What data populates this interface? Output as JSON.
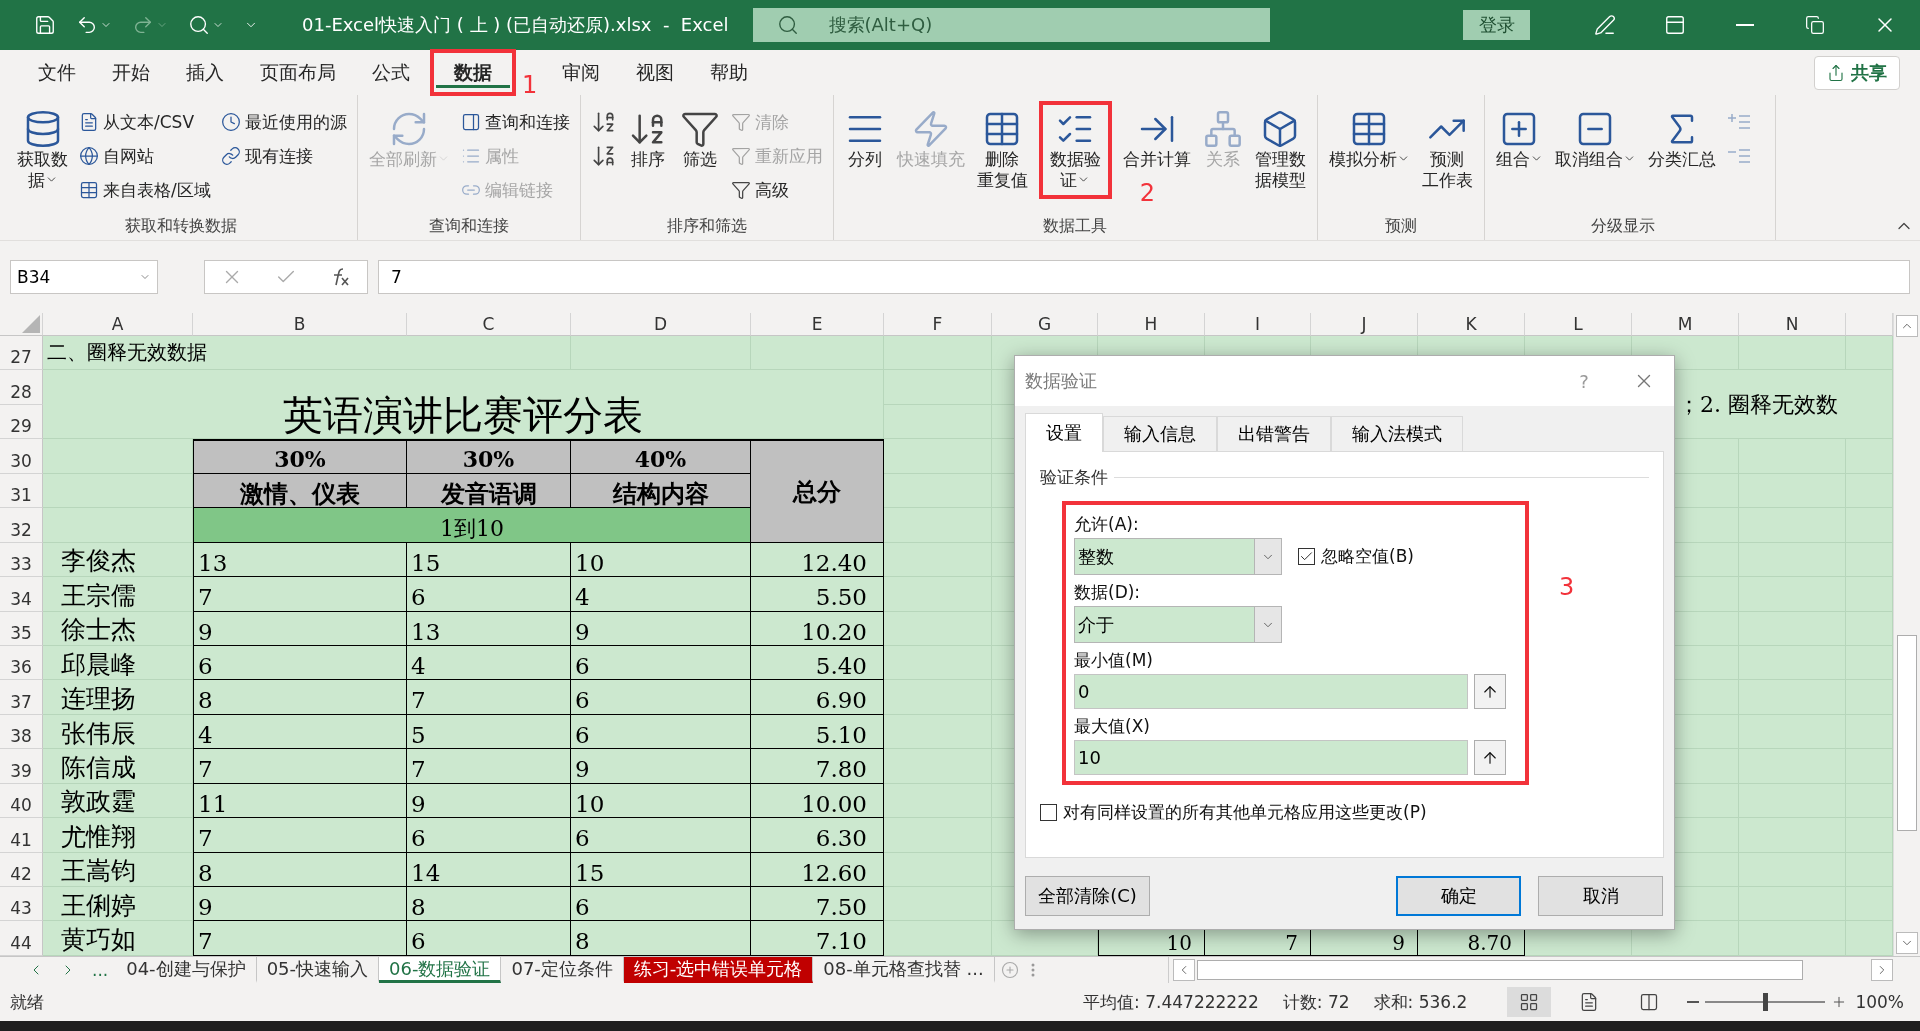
{
  "window": {
    "title": "01-Excel快速入门 ( 上 ) (已自动还原).xlsx  -  Excel",
    "search_placeholder": "搜索(Alt+Q)",
    "login": "登录"
  },
  "menu_tabs": [
    {
      "label": "文件",
      "selected": false
    },
    {
      "label": "开始",
      "selected": false
    },
    {
      "label": "插入",
      "selected": false
    },
    {
      "label": "页面布局",
      "selected": false
    },
    {
      "label": "公式",
      "selected": false
    },
    {
      "label": "数据",
      "selected": true
    },
    {
      "label": "审阅",
      "selected": false
    },
    {
      "label": "视图",
      "selected": false
    },
    {
      "label": "帮助",
      "selected": false
    }
  ],
  "share": "共享",
  "ribbon_groups": [
    {
      "label": "获取和转换数据",
      "items": [
        {
          "kind": "large",
          "lines": [
            "获取数",
            "据"
          ],
          "menu": true,
          "disabled": false
        },
        {
          "kind": "stack",
          "items": [
            {
              "label": "从文本/CSV",
              "disabled": false
            },
            {
              "label": "自网站",
              "disabled": false
            },
            {
              "label": "来自表格/区域",
              "disabled": false
            }
          ]
        },
        {
          "kind": "stack",
          "items": [
            {
              "label": "最近使用的源",
              "disabled": false
            },
            {
              "label": "现有连接",
              "disabled": false
            }
          ]
        }
      ]
    },
    {
      "label": "查询和连接",
      "items": [
        {
          "kind": "large",
          "lines": [
            "全部刷新"
          ],
          "menu": true,
          "disabled": true
        },
        {
          "kind": "stack",
          "items": [
            {
              "label": "查询和连接",
              "disabled": false
            },
            {
              "label": "属性",
              "disabled": true
            },
            {
              "label": "编辑链接",
              "disabled": true
            }
          ]
        }
      ]
    },
    {
      "label": "排序和筛选",
      "items": [
        {
          "kind": "icons",
          "items": [
            {
              "disabled": false
            },
            {
              "disabled": false
            }
          ]
        },
        {
          "kind": "large",
          "lines": [
            "排序"
          ],
          "menu": false,
          "disabled": false
        },
        {
          "kind": "large",
          "lines": [
            "筛选"
          ],
          "menu": false,
          "disabled": false
        },
        {
          "kind": "stack",
          "items": [
            {
              "label": "清除",
              "disabled": true
            },
            {
              "label": "重新应用",
              "disabled": true
            },
            {
              "label": "高级",
              "disabled": false
            }
          ]
        }
      ]
    },
    {
      "label": "数据工具",
      "items": [
        {
          "kind": "large",
          "lines": [
            "分列"
          ],
          "menu": false,
          "disabled": false
        },
        {
          "kind": "large",
          "lines": [
            "快速填充"
          ],
          "menu": false,
          "disabled": true
        },
        {
          "kind": "large",
          "lines": [
            "删除",
            "重复值"
          ],
          "menu": false,
          "disabled": false
        },
        {
          "kind": "large",
          "lines": [
            "数据验",
            "证"
          ],
          "menu": true,
          "disabled": false
        },
        {
          "kind": "large",
          "lines": [
            "合并计算"
          ],
          "menu": false,
          "disabled": false
        },
        {
          "kind": "large",
          "lines": [
            "关系"
          ],
          "menu": false,
          "disabled": true
        },
        {
          "kind": "large",
          "lines": [
            "管理数",
            "据模型"
          ],
          "menu": false,
          "disabled": false
        }
      ]
    },
    {
      "label": "预测",
      "items": [
        {
          "kind": "large",
          "lines": [
            "模拟分析"
          ],
          "menu": true,
          "disabled": false
        },
        {
          "kind": "large",
          "lines": [
            "预测",
            "工作表"
          ],
          "menu": false,
          "disabled": false
        }
      ]
    },
    {
      "label": "分级显示",
      "items": [
        {
          "kind": "large",
          "lines": [
            "组合"
          ],
          "menu": true,
          "disabled": false
        },
        {
          "kind": "large",
          "lines": [
            "取消组合"
          ],
          "menu": true,
          "disabled": false
        },
        {
          "kind": "large",
          "lines": [
            "分类汇总"
          ],
          "menu": false,
          "disabled": false
        },
        {
          "kind": "icons",
          "items": [
            {
              "disabled": true
            },
            {
              "disabled": true
            }
          ]
        }
      ]
    }
  ],
  "annotations": [
    {
      "number": "1"
    },
    {
      "number": "2"
    },
    {
      "number": "3"
    }
  ],
  "formula_bar": {
    "name_box": "B34",
    "formula": "7"
  },
  "sheet": {
    "columns": [
      "A",
      "B",
      "C",
      "D",
      "E",
      "F",
      "G",
      "H",
      "I",
      "J",
      "K",
      "L",
      "M",
      "N"
    ],
    "row_numbers": [
      "27",
      "28",
      "29",
      "30",
      "31",
      "32",
      "33",
      "34",
      "35",
      "36",
      "37",
      "38",
      "39",
      "40",
      "41",
      "42",
      "43",
      "44"
    ],
    "section_title": "二、圈释无效数据",
    "table_title": "英语演讲比赛评分表",
    "weights": [
      "30%",
      "30%",
      "40%"
    ],
    "criteria": [
      "激情、仪表",
      "发音语调",
      "结构内容"
    ],
    "total_header": "总分",
    "range_note": "1到10",
    "records": [
      {
        "name": "李俊杰",
        "scores": [
          "13",
          "15",
          "10"
        ],
        "total": "12.40"
      },
      {
        "name": "王宗儒",
        "scores": [
          "7",
          "6",
          "4"
        ],
        "total": "5.50"
      },
      {
        "name": "徐士杰",
        "scores": [
          "9",
          "13",
          "9"
        ],
        "total": "10.20"
      },
      {
        "name": "邱晨峰",
        "scores": [
          "6",
          "4",
          "6"
        ],
        "total": "5.40"
      },
      {
        "name": "连理扬",
        "scores": [
          "8",
          "7",
          "6"
        ],
        "total": "6.90"
      },
      {
        "name": "张伟辰",
        "scores": [
          "4",
          "5",
          "6"
        ],
        "total": "5.10"
      },
      {
        "name": "陈信成",
        "scores": [
          "7",
          "7",
          "9"
        ],
        "total": "7.80"
      },
      {
        "name": "敦政霆",
        "scores": [
          "11",
          "9",
          "10"
        ],
        "total": "10.00"
      },
      {
        "name": "尤惟翔",
        "scores": [
          "7",
          "6",
          "6"
        ],
        "total": "6.30"
      },
      {
        "name": "王嵩钧",
        "scores": [
          "8",
          "14",
          "15"
        ],
        "total": "12.60"
      },
      {
        "name": "王俐婷",
        "scores": [
          "9",
          "8",
          "6"
        ],
        "total": "7.50"
      },
      {
        "name": "黄巧如",
        "scores": [
          "7",
          "6",
          "8"
        ],
        "total": "7.10"
      }
    ],
    "side_note": "；2. 圈释无效数",
    "background_row": [
      "10",
      "7",
      "9",
      "8.70"
    ]
  },
  "dialog": {
    "title": "数据验证",
    "help": "?",
    "tabs": [
      {
        "label": "设置",
        "selected": true
      },
      {
        "label": "输入信息",
        "selected": false
      },
      {
        "label": "出错警告",
        "selected": false
      },
      {
        "label": "输入法模式",
        "selected": false
      }
    ],
    "section": "验证条件",
    "allow": {
      "label": "允许(A):",
      "value": "整数"
    },
    "ignore_blank": {
      "label": "忽略空值(B)",
      "checked": true
    },
    "data": {
      "label": "数据(D):",
      "value": "介于"
    },
    "minimum": {
      "label": "最小值(M)",
      "value": "0"
    },
    "maximum": {
      "label": "最大值(X)",
      "value": "10"
    },
    "apply_all": {
      "label": "对有同样设置的所有其他单元格应用这些更改(P)",
      "checked": false
    },
    "buttons": [
      {
        "label": "全部清除(C)",
        "default": false
      },
      {
        "label": "确定",
        "default": true
      },
      {
        "label": "取消",
        "default": false
      }
    ]
  },
  "sheet_tabs": {
    "more": "...",
    "tabs": [
      {
        "label": "04-创建与保护",
        "selected": false
      },
      {
        "label": "05-快速输入",
        "selected": false
      },
      {
        "label": "06-数据验证",
        "selected": true
      },
      {
        "label": "07-定位条件",
        "selected": false
      },
      {
        "label": "练习-选中错误单元格",
        "selected": false,
        "color": "#c00000"
      },
      {
        "label": "08-单元格查找替 ...",
        "selected": false
      }
    ]
  },
  "status_bar": {
    "ready": "就绪",
    "average": "平均值: 7.447222222",
    "count": "计数: 72",
    "sum": "求和: 536.2",
    "zoom": "100%",
    "zoom_slider": {
      "level": 0.5
    }
  }
}
